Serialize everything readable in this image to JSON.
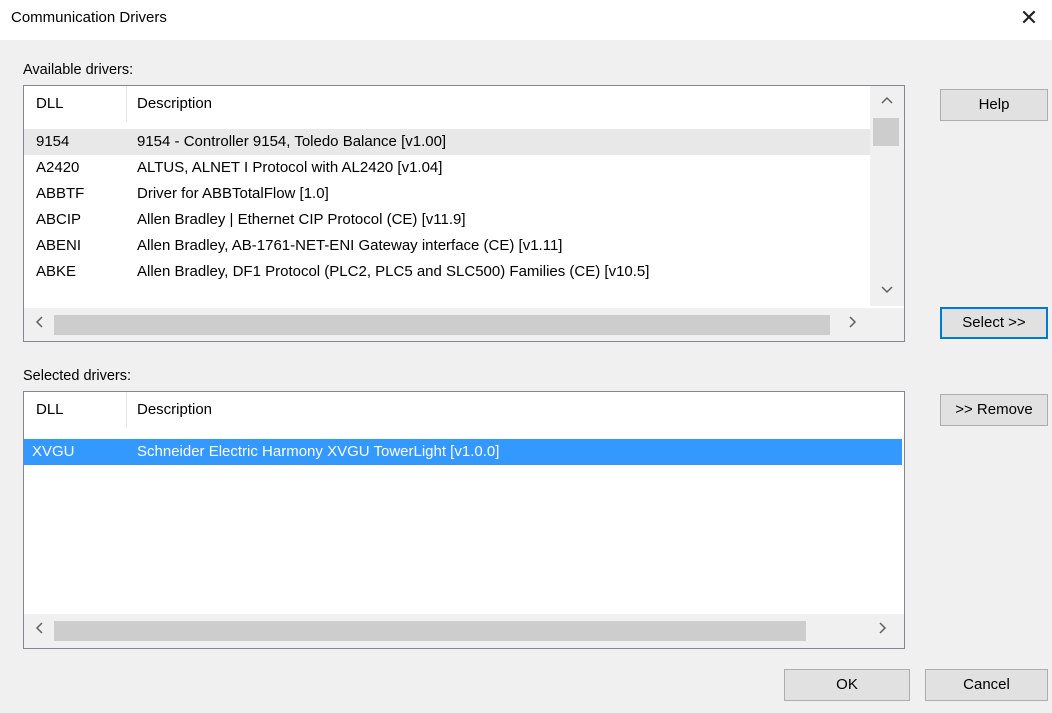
{
  "window": {
    "title": "Communication Drivers",
    "close_glyph": "✕"
  },
  "available": {
    "label": "Available drivers:",
    "columns": {
      "dll": "DLL",
      "description": "Description"
    },
    "rows": [
      {
        "dll": "9154",
        "description": "9154 - Controller 9154, Toledo Balance [v1.00]"
      },
      {
        "dll": "A2420",
        "description": "ALTUS, ALNET I Protocol with AL2420 [v1.04]"
      },
      {
        "dll": "ABBTF",
        "description": "Driver for ABBTotalFlow [1.0]"
      },
      {
        "dll": "ABCIP",
        "description": "Allen Bradley | Ethernet CIP Protocol (CE) [v11.9]"
      },
      {
        "dll": "ABENI",
        "description": "Allen Bradley, AB-1761-NET-ENI Gateway interface (CE) [v1.11]"
      },
      {
        "dll": "ABKE",
        "description": "Allen Bradley, DF1 Protocol (PLC2, PLC5 and SLC500) Families (CE) [v10.5]"
      }
    ]
  },
  "selected": {
    "label": "Selected drivers:",
    "columns": {
      "dll": "DLL",
      "description": "Description"
    },
    "rows": [
      {
        "dll": "XVGU",
        "description": "Schneider Electric Harmony XVGU TowerLight [v1.0.0]"
      }
    ]
  },
  "buttons": {
    "help": "Help",
    "select": "Select >>",
    "remove": ">> Remove",
    "ok": "OK",
    "cancel": "Cancel"
  },
  "icons": {
    "up": "chevron-up-icon",
    "down": "chevron-down-icon",
    "left": "chevron-left-icon",
    "right": "chevron-right-icon"
  },
  "colors": {
    "selection": "#3399ff",
    "hover": "#e8e8e8",
    "default_button_border": "#0078d7"
  }
}
